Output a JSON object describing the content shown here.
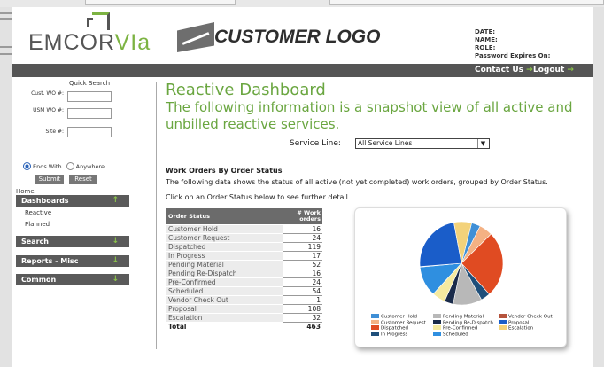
{
  "header": {
    "brand_main": "EMCOR",
    "brand_accent": "VIa",
    "customer_logo": "CUSTOMER LOGO",
    "user_info": [
      "DATE:",
      "NAME:",
      "ROLE:",
      "Password Expires On:"
    ]
  },
  "topbar": {
    "contact": "Contact Us",
    "logout": "Logout",
    "arrow": "→"
  },
  "sidebar": {
    "quick_search_title": "Quick Search",
    "fields": [
      {
        "label": "Cust. WO #:",
        "value": ""
      },
      {
        "label": "USM WO #:",
        "value": ""
      },
      {
        "label": "Site #:",
        "value": ""
      }
    ],
    "radio_ends_with": "Ends With",
    "radio_anywhere": "Anywhere",
    "submit": "Submit",
    "reset": "Reset",
    "home": "Home",
    "nav": [
      {
        "label": "Dashboards",
        "arrow": "↑"
      },
      {
        "label": "Search",
        "arrow": "↓"
      },
      {
        "label": "Reports - Misc",
        "arrow": "↓"
      },
      {
        "label": "Common",
        "arrow": "↓"
      }
    ],
    "dashboards_items": [
      "Reactive",
      "Planned"
    ]
  },
  "main": {
    "title": "Reactive Dashboard",
    "subtitle": "The following information is a snapshot view of all active and unbilled reactive services.",
    "service_line_label": "Service Line:",
    "service_line_value": "All Service Lines",
    "section_title": "Work Orders By Order Status",
    "desc1": "The following data shows the status of all active (not yet completed) work orders, grouped by Order Status.",
    "desc2": "Click on an Order Status below to see further detail.",
    "table": {
      "col_status": "Order Status",
      "col_count": "# Work orders",
      "rows": [
        {
          "status": "Customer Hold",
          "count": "16"
        },
        {
          "status": "Customer Request",
          "count": "24"
        },
        {
          "status": "Dispatched",
          "count": "119"
        },
        {
          "status": "In Progress",
          "count": "17"
        },
        {
          "status": "Pending Material",
          "count": "52"
        },
        {
          "status": "Pending Re-Dispatch",
          "count": "16"
        },
        {
          "status": "Pre-Confirmed",
          "count": "24"
        },
        {
          "status": "Scheduled",
          "count": "54"
        },
        {
          "status": "Vendor Check Out",
          "count": "1"
        },
        {
          "status": "Proposal",
          "count": "108"
        },
        {
          "status": "Escalation",
          "count": "32"
        }
      ],
      "total_label": "Total",
      "total_value": "463"
    }
  },
  "chart_data": {
    "type": "pie",
    "title": "",
    "legend_placement": "bottom",
    "slices": [
      {
        "name": "Customer Hold",
        "value": 16,
        "color": "#3f8fd6"
      },
      {
        "name": "Customer Request",
        "value": 24,
        "color": "#f4b183"
      },
      {
        "name": "Dispatched",
        "value": 119,
        "color": "#e04b22"
      },
      {
        "name": "In Progress",
        "value": 17,
        "color": "#1f4f7a"
      },
      {
        "name": "Pending Material",
        "value": 52,
        "color": "#b8b8b8"
      },
      {
        "name": "Pending Re-Dispatch",
        "value": 16,
        "color": "#1a2b4a"
      },
      {
        "name": "Pre-Confirmed",
        "value": 24,
        "color": "#f5eaa0"
      },
      {
        "name": "Scheduled",
        "value": 54,
        "color": "#2f8fe0"
      },
      {
        "name": "Vendor Check Out",
        "value": 1,
        "color": "#b5533c"
      },
      {
        "name": "Proposal",
        "value": 108,
        "color": "#1a5dc9"
      },
      {
        "name": "Escalation",
        "value": 32,
        "color": "#f3d27a"
      }
    ]
  },
  "colors": {
    "accent_green": "#6aa640",
    "bar_gray": "#555555"
  }
}
